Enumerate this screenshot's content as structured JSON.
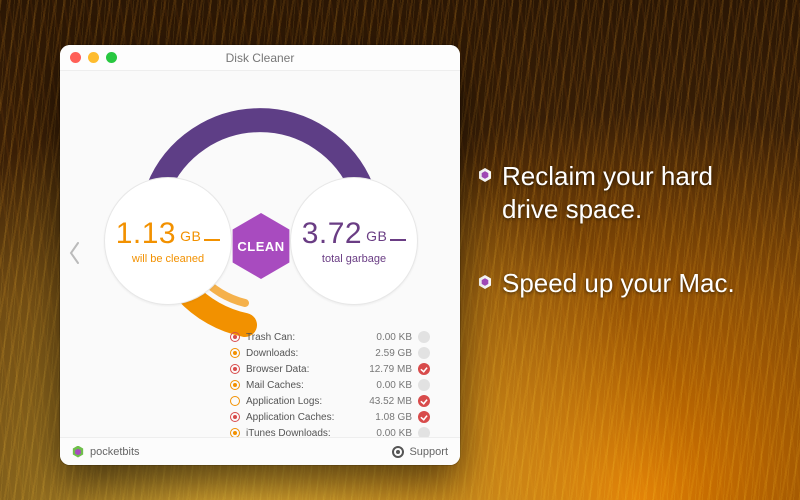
{
  "promo": {
    "line1a": "Reclaim your hard",
    "line1b": "drive space.",
    "line2": "Speed up your Mac."
  },
  "window": {
    "title": "Disk Cleaner",
    "clean_button": "CLEAN",
    "cleaned": {
      "value": "1.13",
      "unit": "GB",
      "label": "will be cleaned"
    },
    "garbage": {
      "value": "3.72",
      "unit": "GB",
      "label": "total garbage"
    },
    "items": [
      {
        "icon": "red",
        "selected": true,
        "name": "Trash Can:",
        "size": "0.00 KB",
        "checked": false
      },
      {
        "icon": "orange",
        "selected": true,
        "name": "Downloads:",
        "size": "2.59 GB",
        "checked": false
      },
      {
        "icon": "red",
        "selected": true,
        "name": "Browser Data:",
        "size": "12.79 MB",
        "checked": true
      },
      {
        "icon": "orange",
        "selected": true,
        "name": "Mail Caches:",
        "size": "0.00 KB",
        "checked": false
      },
      {
        "icon": "orange",
        "selected": false,
        "name": "Application Logs:",
        "size": "43.52 MB",
        "checked": true
      },
      {
        "icon": "red",
        "selected": true,
        "name": "Application Caches:",
        "size": "1.08 GB",
        "checked": true
      },
      {
        "icon": "orange",
        "selected": true,
        "name": "iTunes Downloads:",
        "size": "0.00 KB",
        "checked": false
      }
    ],
    "footer": {
      "brand": "pocketbits",
      "support": "Support"
    }
  },
  "colors": {
    "orange": "#f29100",
    "purple": "#6a3d84",
    "magenta": "#a84bbf"
  }
}
